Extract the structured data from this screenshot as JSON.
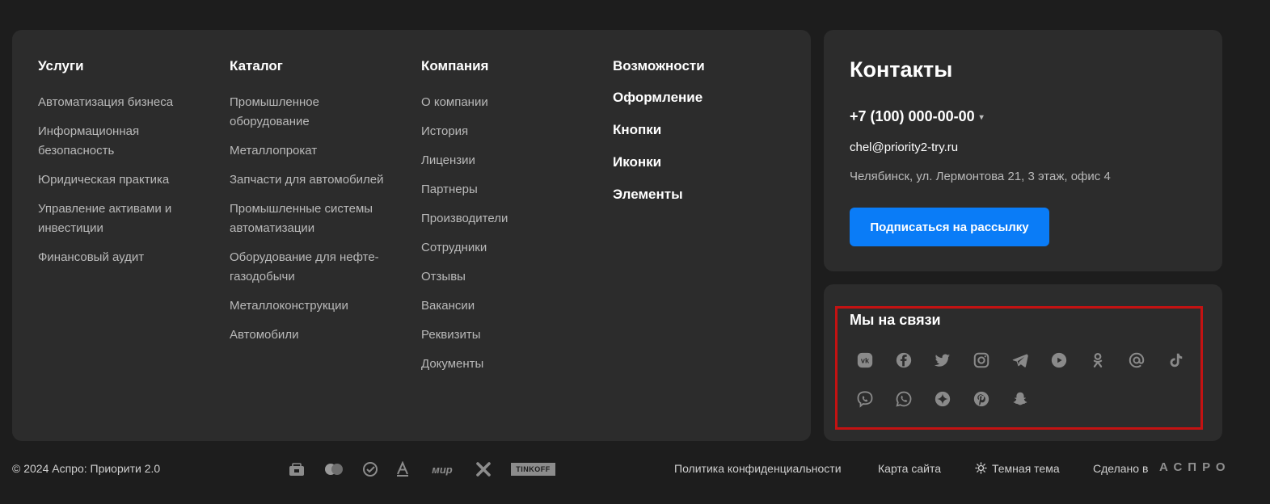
{
  "columns": [
    {
      "title": "Услуги",
      "items": [
        "Автоматизация бизнеса",
        "Информационная безопасность",
        "Юридическая практика",
        "Управление активами и инвестиции",
        "Финансовый аудит"
      ]
    },
    {
      "title": "Каталог",
      "items": [
        "Промышленное оборудование",
        "Металлопрокат",
        "Запчасти для автомобилей",
        "Промышленные системы автоматизации",
        "Оборудование для нефте-газодобычи",
        "Металлоконструкции",
        "Автомобили"
      ]
    },
    {
      "title": "Компания",
      "items": [
        "О компании",
        "История",
        "Лицензии",
        "Партнеры",
        "Производители",
        "Сотрудники",
        "Отзывы",
        "Вакансии",
        "Реквизиты",
        "Документы"
      ]
    },
    {
      "title": "Возможности",
      "items": [
        "Оформление",
        "Кнопки",
        "Иконки",
        "Элементы"
      ]
    }
  ],
  "contacts": {
    "title": "Контакты",
    "phone": "+7 (100) 000-00-00",
    "email": "chel@priority2-try.ru",
    "address": "Челябинск, ул. Лермонтова 21, 3 этаж, офис 4",
    "subscribe_label": "Подписаться на рассылку"
  },
  "social": {
    "title": "Мы на связи",
    "icons": [
      "vk-icon",
      "facebook-icon",
      "twitter-icon",
      "instagram-icon",
      "telegram-icon",
      "youtube-icon",
      "odnoklassniki-icon",
      "mail-ru-icon",
      "tiktok-icon",
      "viber-icon",
      "whatsapp-icon",
      "zen-icon",
      "pinterest-icon",
      "snapchat-icon"
    ]
  },
  "footer": {
    "copyright": "© 2024 Аспро: Приорити 2.0",
    "payment_icons": [
      "visa-icon",
      "mastercard-icon",
      "sbp-icon",
      "alfa-icon"
    ],
    "mir": "мир",
    "tinkoff": "TINKOFF",
    "privacy": "Политика конфиденциальности",
    "sitemap": "Карта сайта",
    "theme": "Темная тема",
    "made_by": "Сделано в",
    "made_by_brand": "АСПРО"
  },
  "colors": {
    "accent": "#0a7cf7",
    "highlight": "#c41212",
    "panel": "#2c2c2c",
    "background": "#1d1d1d"
  }
}
